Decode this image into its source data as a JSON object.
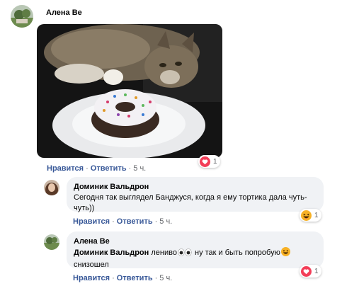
{
  "comment1": {
    "author": "Алена Ве",
    "actions": {
      "like": "Нравится",
      "reply": "Ответить",
      "time": "5 ч."
    },
    "reaction": {
      "icon": "heart-reaction-icon",
      "count": "1",
      "color": "#f33e58"
    }
  },
  "reply1": {
    "author": "Доминик Вальдрон",
    "text": "Сегодня так выглядел Банджуся, когда я ему тортика дала чуть-чуть))",
    "actions": {
      "like": "Нравится",
      "reply": "Ответить",
      "time": "5 ч."
    },
    "reaction": {
      "icon": "haha-reaction-icon",
      "count": "1",
      "color": "#f7b125"
    }
  },
  "reply2": {
    "author": "Алена Ве",
    "mention": "Доминик Вальдрон",
    "text_a": " лениво",
    "text_b": " ну так и быть попробую",
    "text_c": "снизошел",
    "actions": {
      "like": "Нравится",
      "reply": "Ответить",
      "time": "5 ч."
    },
    "reaction": {
      "icon": "heart-reaction-icon",
      "count": "1",
      "color": "#f33e58"
    }
  },
  "separator": "·"
}
